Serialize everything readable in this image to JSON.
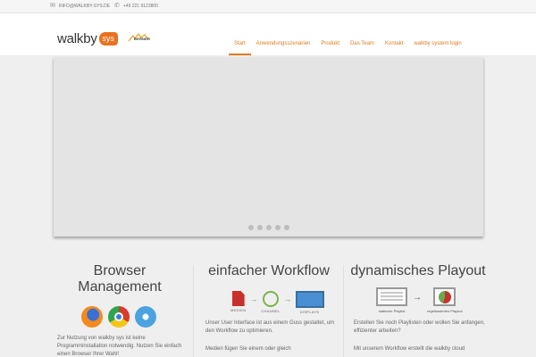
{
  "topbar": {
    "email": "INFO@WALKBY-SYS.DE",
    "phone": "+49 221 9123800",
    "email_icon": "envelope-icon",
    "phone_icon": "phone-icon"
  },
  "header": {
    "logo_text": "walkby",
    "logo_badge": "sys",
    "partner_text": "BERNER"
  },
  "nav": {
    "items": [
      {
        "label": "Start",
        "active": true
      },
      {
        "label": "Anwendungsszenarien",
        "active": false
      },
      {
        "label": "Produkt",
        "active": false
      },
      {
        "label": "Das Team",
        "active": false
      },
      {
        "label": "Kontakt",
        "active": false
      },
      {
        "label": "walkby system login",
        "active": false
      }
    ]
  },
  "slider": {
    "dot_count": 5
  },
  "columns": {
    "browser": {
      "title": "Browser Management",
      "text": "Zur Nutzung von walkby sys ist keine Programminstallation notwendig. Nutzen Sie einfach einen Browser Ihrer Wahl!"
    },
    "workflow": {
      "title": "einfacher Workflow",
      "steps": [
        "MEDIEN",
        "CHANNEL",
        "DISPLAYS"
      ],
      "text1": "Unser User Interface ist aus einem Guss gestaltet, um den Workflow zu optimieren.",
      "text2": "Medien fügen Sie einem oder gleich"
    },
    "playout": {
      "title": "dynamisches Playout",
      "static_label": "statische Playlist",
      "rule_label": "regelbasiertes Playout",
      "text1": "Erstellen Sie noch Playlisten oder wollen Sie anfangen, effizienter arbeiten?",
      "text2": "Mit unserem Workflow erstellt die walkby cloud"
    }
  },
  "colors": {
    "accent": "#e07b1f",
    "slider_bg": "#e4e4e4"
  }
}
